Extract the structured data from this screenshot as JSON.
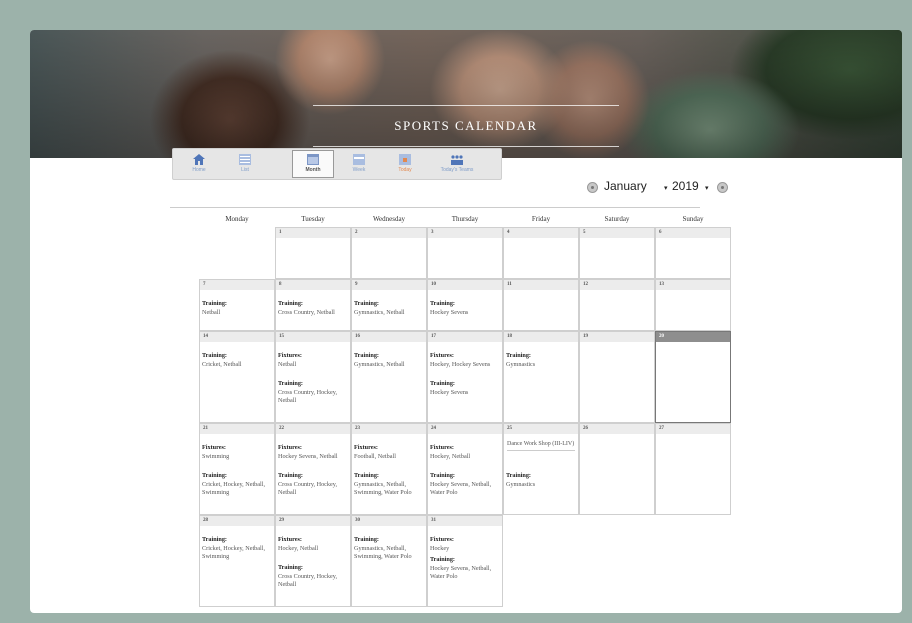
{
  "header": {
    "title": "SPORTS CALENDAR"
  },
  "toolbar": {
    "buttons": [
      {
        "label": "Home",
        "icon": "home-icon"
      },
      {
        "label": "List",
        "icon": "list-icon"
      },
      {
        "label": "Month",
        "icon": "month-icon"
      },
      {
        "label": "Week",
        "icon": "week-icon"
      },
      {
        "label": "Today",
        "icon": "today-icon"
      },
      {
        "label": "Today's Teams",
        "icon": "teams-icon"
      }
    ],
    "active": "Month",
    "month": "January",
    "year": "2019"
  },
  "days": [
    "Monday",
    "Tuesday",
    "Wednesday",
    "Thursday",
    "Friday",
    "Saturday",
    "Sunday"
  ],
  "cells": {
    "d1": "1",
    "d2": "2",
    "d3": "3",
    "d4": "4",
    "d5": "5",
    "d6": "6",
    "d7": "7",
    "d8": "8",
    "d9": "9",
    "d10": "10",
    "d11": "11",
    "d12": "12",
    "d13": "13",
    "d14": "14",
    "d15": "15",
    "d16": "16",
    "d17": "17",
    "d18": "18",
    "d19": "19",
    "d20": "20",
    "d21": "21",
    "d22": "22",
    "d23": "23",
    "d24": "24",
    "d25": "25",
    "d26": "26",
    "d27": "27",
    "d28": "28",
    "d29": "29",
    "d30": "30",
    "d31": "31"
  },
  "labels": {
    "training": "Training:",
    "fixtures": "Fixtures:"
  },
  "events": {
    "e7": "Netball",
    "e8": "Cross Country, Netball",
    "e9": "Gymnastics, Netball",
    "e10": "Hockey Sevens",
    "e14": "Cricket, Netball",
    "e15f": "Netball",
    "e15t": "Cross Country, Hockey, Netball",
    "e16": "Gymnastics, Netball",
    "e17f": "Hockey, Hockey Sevens",
    "e17t": "Hockey Sevens",
    "e18": "Gymnastics",
    "e21f": "Swimming",
    "e21t": "Cricket, Hockey, Netball, Swimming",
    "e22f": "Hockey Sevens, Netball",
    "e22t": "Cross Country, Hockey, Netball",
    "e23f": "Football, Netball",
    "e23t": "Gymnastics, Netball, Swimming, Water Polo",
    "e24f": "Hockey, Netball",
    "e24t": "Hockey Sevens, Netball, Water Polo",
    "e25box": "Dance Work Shop (III-LIV)",
    "e25t": "Gymnastics",
    "e28": "Cricket, Hockey, Netball, Swimming",
    "e29f": "Hockey, Netball",
    "e29t": "Cross Country, Hockey, Netball",
    "e30": "Gymnastics, Netball, Swimming, Water Polo",
    "e31f": "Hockey",
    "e31t": "Hockey Sevens, Netball, Water Polo"
  },
  "colors": {
    "frame": "#9cb2aa",
    "today_header": "#8e8e8e",
    "toolbar_icon": "#7f9cc8",
    "today_label": "#e2884f"
  }
}
